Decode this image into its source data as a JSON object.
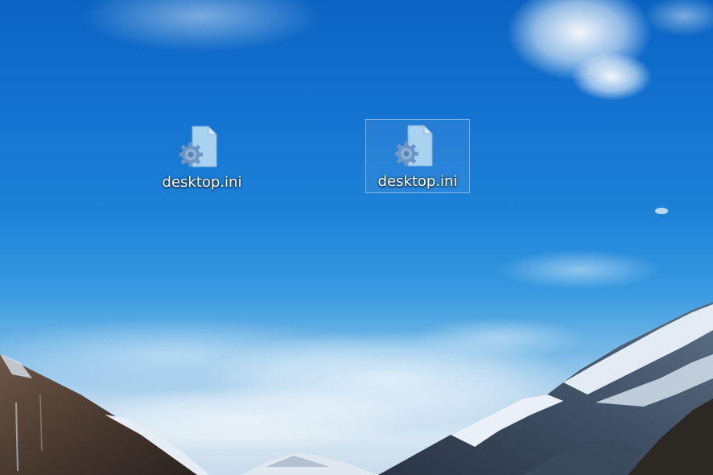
{
  "desktop": {
    "icons": [
      {
        "label": "desktop.ini",
        "icon": "settings-file-icon",
        "selected": false
      },
      {
        "label": "desktop.ini",
        "icon": "settings-file-icon",
        "selected": true
      }
    ]
  },
  "colors": {
    "sky_top": "#0a63c2",
    "sky_mid": "#1d82d8",
    "horizon": "#d6e6f2",
    "file_icon": "#9fcbea",
    "gear": "#5b86b8",
    "selection_border": "#b7cde0"
  }
}
